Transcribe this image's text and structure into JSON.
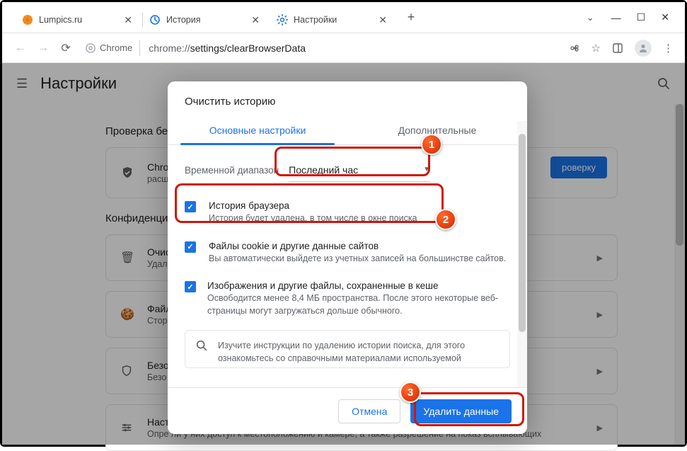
{
  "tabs": [
    {
      "title": "Lumpics.ru"
    },
    {
      "title": "История"
    },
    {
      "title": "Настройки"
    }
  ],
  "address": {
    "chip": "Chrome",
    "url_prefix": "chrome://",
    "url_path": "settings/clearBrowserData"
  },
  "page": {
    "title": "Настройки",
    "section_check": "Проверка бе",
    "card_check_title": "Chro",
    "card_check_sub": "расш",
    "btn_check": "роверку",
    "section_priv": "Конфиденци",
    "card1_title": "Очис",
    "card1_sub": "Удал",
    "card2_title": "Файл",
    "card2_sub": "Стор",
    "card3_title": "Безо",
    "card3_sub": "Безо",
    "card4_title": "Настр",
    "card4_sub": "Опре                        ли у них доступ к местоположению и камере, а также разрешение на показ всплывающих"
  },
  "dialog": {
    "title": "Очистить историю",
    "tab_basic": "Основные настройки",
    "tab_adv": "Дополнительные",
    "time_label": "Временной диапазон",
    "time_value": "Последний час",
    "opt1_h": "История браузера",
    "opt1_s": "История будет удалена, в том числе в окне поиска",
    "opt2_h": "Файлы cookie и другие данные сайтов",
    "opt2_s": "Вы автоматически выйдете из учетных записей на большинстве сайтов.",
    "opt3_h": "Изображения и другие файлы, сохраненные в кеше",
    "opt3_s": "Освободится менее 8,4 МБ пространства. После этого некоторые веб-страницы могут загружаться дольше обычного.",
    "info": "Изучите инструкции по удалению истории поиска, для этого ознакомьтесь со справочными материалами используемой",
    "cancel": "Отмена",
    "confirm": "Удалить данные"
  },
  "badges": {
    "b1": "1",
    "b2": "2",
    "b3": "3"
  }
}
